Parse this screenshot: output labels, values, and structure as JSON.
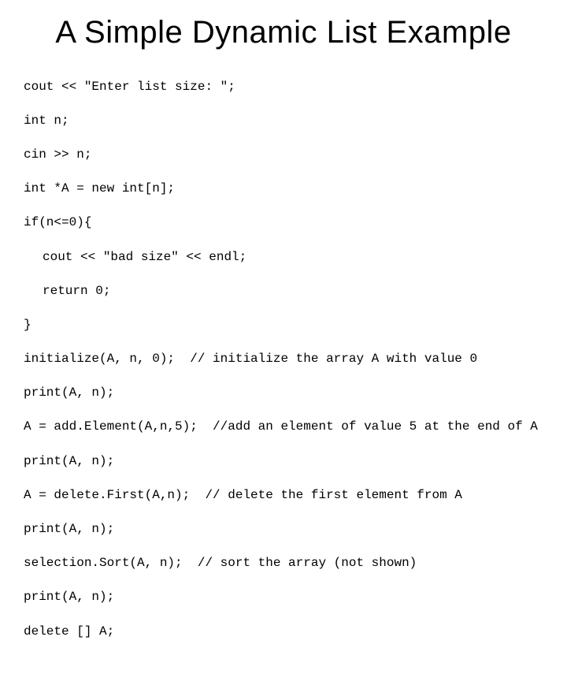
{
  "title": "A Simple Dynamic List Example",
  "code": {
    "l1": "cout << \"Enter list size: \";",
    "l2": "int n;",
    "l3": "cin >> n;",
    "l4": "int *A = new int[n];",
    "l5": "if(n<=0){",
    "l6": "cout << \"bad size\" << endl;",
    "l7": "return 0;",
    "l8": "}",
    "l9": "initialize(A, n, 0);  // initialize the array A with value 0",
    "l10": "print(A, n);",
    "l11": "A = add.Element(A,n,5);  //add an element of value 5 at the end of A",
    "l12": "print(A, n);",
    "l13": "A = delete.First(A,n);  // delete the first element from A",
    "l14": "print(A, n);",
    "l15": "selection.Sort(A, n);  // sort the array (not shown)",
    "l16": "print(A, n);",
    "l17": "delete [] A;"
  }
}
